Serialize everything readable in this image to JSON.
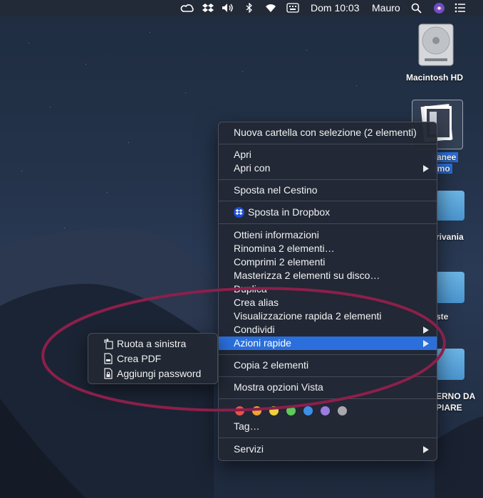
{
  "menubar": {
    "clock": "Dom 10:03",
    "user": "Mauro",
    "icons": [
      "creative-cloud-icon",
      "dropbox-icon",
      "volume-icon",
      "bluetooth-icon",
      "wifi-icon",
      "keyboard-icon",
      "search-icon",
      "siri-icon",
      "notification-center-icon"
    ]
  },
  "desktop": {
    "icons": [
      {
        "label": "Macintosh HD",
        "icon": "hard-drive-icon"
      },
      {
        "label_line1": "tanee",
        "label_line2": "rmo",
        "icon": "screenshot-thumbnail-icon"
      },
      {
        "label": "rivania",
        "icon": "folder-icon"
      },
      {
        "label": "ste",
        "icon": "folder-icon"
      },
      {
        "label_line1": "ERNO DA",
        "label_line2": "PIARE",
        "icon": "folder-icon"
      }
    ]
  },
  "context_menu": {
    "new_folder": "Nuova cartella con selezione (2 elementi)",
    "open": "Apri",
    "open_with": "Apri con",
    "move_to_trash": "Sposta nel Cestino",
    "move_to_dropbox": "Sposta in Dropbox",
    "get_info": "Ottieni informazioni",
    "rename": "Rinomina 2 elementi…",
    "compress": "Comprimi 2 elementi",
    "burn": "Masterizza 2 elementi su disco…",
    "duplicate": "Duplica",
    "make_alias": "Crea alias",
    "quick_look": "Visualizzazione rapida 2 elementi",
    "share": "Condividi",
    "quick_actions": "Azioni rapide",
    "copy": "Copia 2 elementi",
    "show_view_options": "Mostra opzioni Vista",
    "tags": "Tag…",
    "services": "Servizi",
    "tag_colors": [
      "#e8534b",
      "#f0a33a",
      "#efcf3d",
      "#5dca5a",
      "#3d8fe8",
      "#9b7de0",
      "#a8a8ad"
    ]
  },
  "submenu": {
    "rotate_left": "Ruota a sinistra",
    "create_pdf": "Crea PDF",
    "add_password": "Aggiungi password"
  },
  "annotation": {
    "ellipse_color": "#8c1f4a"
  }
}
